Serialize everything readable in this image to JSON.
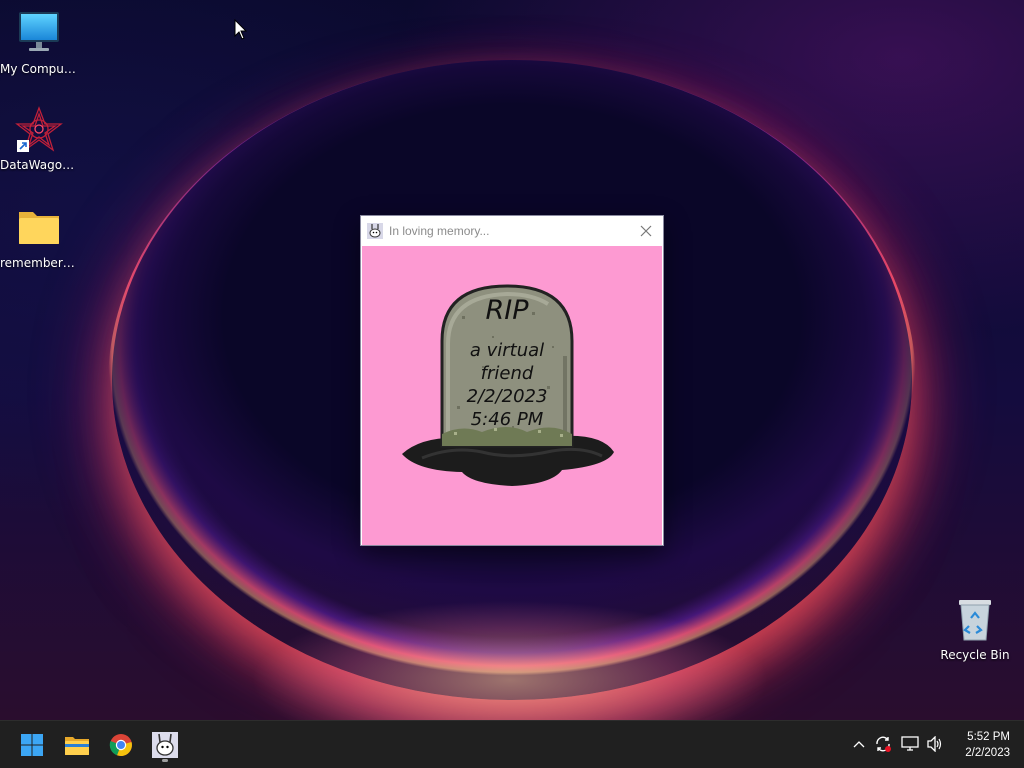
{
  "desktop": {
    "icons": [
      {
        "label": "My Computer",
        "icon": "monitor-icon"
      },
      {
        "label": "DataWagon...",
        "icon": "datawagon-shortcut-icon"
      },
      {
        "label": "remember_...",
        "icon": "folder-icon"
      },
      {
        "label": "Recycle Bin",
        "icon": "recycle-bin-icon"
      }
    ]
  },
  "window": {
    "title": "In loving memory...",
    "tombstone": {
      "heading": "RIP",
      "line1": "a virtual",
      "line2": "friend",
      "date": "2/2/2023",
      "time": "5:46 PM"
    },
    "colors": {
      "background": "#fd9ad2",
      "stone": "#8e907e",
      "ground": "#1c1c1c"
    }
  },
  "taskbar": {
    "apps": [
      {
        "name": "Start",
        "icon": "windows-start-icon"
      },
      {
        "name": "File Explorer",
        "icon": "folder-icon"
      },
      {
        "name": "Google Chrome",
        "icon": "chrome-icon"
      },
      {
        "name": "In loving memory...",
        "icon": "virtual-pet-icon",
        "active": true
      }
    ],
    "tray": [
      "chevron-up-icon",
      "sync-icon",
      "network-icon",
      "volume-icon"
    ],
    "clock": {
      "time": "5:52 PM",
      "date": "2/2/2023"
    }
  }
}
